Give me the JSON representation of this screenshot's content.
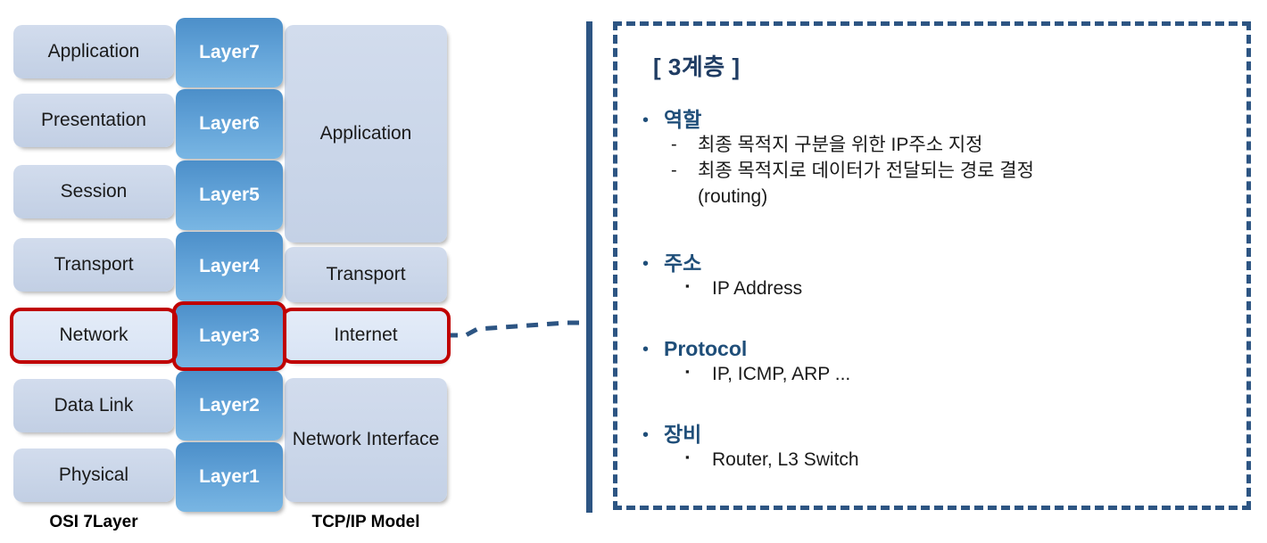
{
  "diagram": {
    "osi_caption": "OSI 7Layer",
    "tcpip_caption": "TCP/IP Model",
    "highlight_color": "#c00000",
    "layer_accent_color": "#5fa0d6",
    "rows": [
      {
        "osi": "Application",
        "num": "Layer7",
        "tcp": "Application",
        "highlight": false
      },
      {
        "osi": "Presentation",
        "num": "Layer6",
        "tcp": "",
        "highlight": false
      },
      {
        "osi": "Session",
        "num": "Layer5",
        "tcp": "",
        "highlight": false
      },
      {
        "osi": "Transport",
        "num": "Layer4",
        "tcp": "Transport",
        "highlight": false
      },
      {
        "osi": "Network",
        "num": "Layer3",
        "tcp": "Internet",
        "highlight": true
      },
      {
        "osi": "Data Link",
        "num": "Layer2",
        "tcp": "Network\nInterface",
        "highlight": false
      },
      {
        "osi": "Physical",
        "num": "Layer1",
        "tcp": "",
        "highlight": false
      }
    ],
    "tcp_groups": [
      {
        "label": "Application",
        "from_row": 0,
        "to_row": 2
      },
      {
        "label": "Transport",
        "from_row": 3,
        "to_row": 3
      },
      {
        "label": "Internet",
        "from_row": 4,
        "to_row": 4
      },
      {
        "label": "Network Interface",
        "from_row": 5,
        "to_row": 6
      }
    ]
  },
  "detail": {
    "title": "[ 3계층 ]",
    "border_color": "#2d5583",
    "heading_color": "#1f4e79",
    "sections": [
      {
        "heading": "역할",
        "marker": "dash",
        "items": [
          "최종 목적지 구분을 위한 IP주소 지정",
          "최종 목적지로 데이터가 전달되는 경로 결정\n(routing)"
        ]
      },
      {
        "heading": "주소",
        "marker": "square",
        "items": [
          "IP Address"
        ]
      },
      {
        "heading": "Protocol",
        "marker": "square",
        "items": [
          "IP, ICMP, ARP ..."
        ]
      },
      {
        "heading": "장비",
        "marker": "square",
        "items": [
          "Router, L3 Switch"
        ]
      }
    ]
  },
  "glyphs": {
    "bullet": "•",
    "dash": "-",
    "square": "▪"
  }
}
